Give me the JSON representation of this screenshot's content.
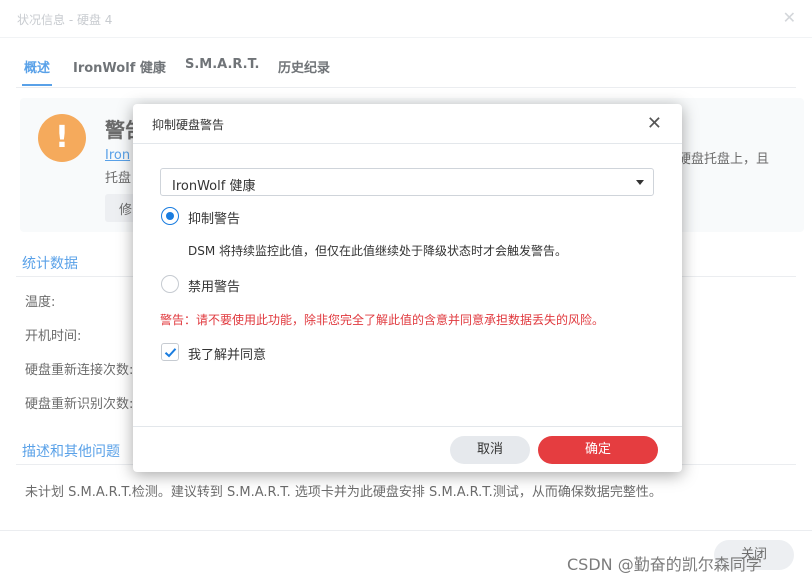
{
  "window": {
    "title": "状况信息 - 硬盘 4"
  },
  "tabs": [
    {
      "label": "概述"
    },
    {
      "label": "IronWolf 健康"
    },
    {
      "label": "S.M.A.R.T."
    },
    {
      "label": "历史纪录"
    }
  ],
  "alert": {
    "heading": "警告",
    "link_text": "Iron",
    "line2": "托盘",
    "right_text": "硬盘托盘上，且",
    "repair_label": "修"
  },
  "stats": {
    "title": "统计数据",
    "rows": [
      {
        "label": "温度:"
      },
      {
        "label": "开机时间:"
      },
      {
        "label": "硬盘重新连接次数:"
      },
      {
        "label": "硬盘重新识别次数:"
      }
    ]
  },
  "description": {
    "title": "描述和其他问题",
    "text": "未计划 S.M.A.R.T.检测。建议转到 S.M.A.R.T. 选项卡并为此硬盘安排 S.M.A.R.T.测试，从而确保数据完整性。"
  },
  "footer": {
    "close_label": "关闭"
  },
  "watermark": "CSDN @勤奋的凯尔森同学",
  "modal": {
    "title": "抑制硬盘警告",
    "select_value": "IronWolf 健康",
    "options": [
      {
        "label": "抑制警告",
        "selected": true,
        "description": "DSM 将持续监控此值，但仅在此值继续处于降级状态时才会触发警告。"
      },
      {
        "label": "禁用警告",
        "selected": false
      }
    ],
    "warning": "警告：请不要使用此功能，除非您完全了解此值的含意并同意承担数据丢失的风险。",
    "agree_label": "我了解并同意",
    "agree_checked": true,
    "cancel_label": "取消",
    "ok_label": "确定"
  },
  "colors": {
    "accent": "#1a7de0",
    "danger": "#e53d40",
    "alert": "#f28a1e"
  }
}
